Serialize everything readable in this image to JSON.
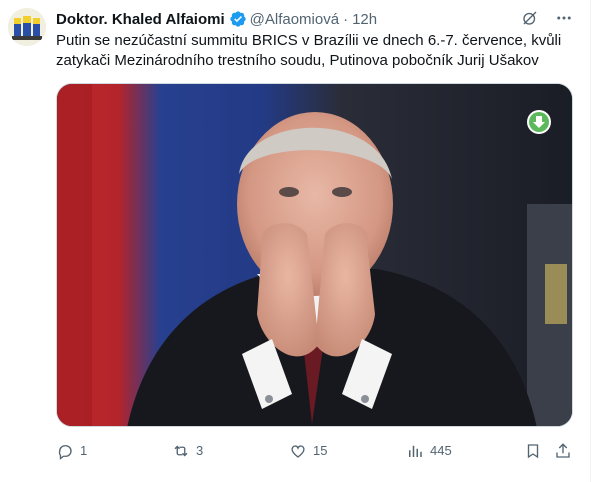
{
  "author": {
    "name": "Doktor. Khaled Alfaiomi",
    "handle": "@Alfaomiová",
    "separator": "·",
    "time": "12h"
  },
  "tweet_text": "Putin se nezúčastní summitu BRICS v Brazílii ve dnech 6.-7. července, kvůli zatykači Mezinárodního trestního soudu, Putinova pobočník Jurij Ušakov",
  "actions": {
    "replies": "1",
    "retweets": "3",
    "likes": "15",
    "views": "445"
  },
  "colors": {
    "accent": "#1d9bf0",
    "muted": "#536471",
    "download_green": "#5cb85c"
  },
  "icons": {
    "verified": "verified-badge-icon",
    "grok": "grok-icon",
    "more": "more-icon",
    "reply": "reply-icon",
    "retweet": "retweet-icon",
    "like": "like-icon",
    "views": "views-icon",
    "bookmark": "bookmark-icon",
    "share": "share-icon",
    "download": "download-icon"
  }
}
